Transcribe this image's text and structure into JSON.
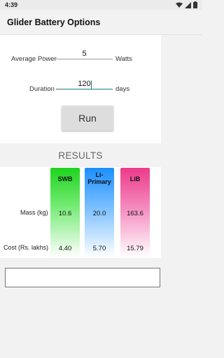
{
  "status_bar": {
    "time": "4:39",
    "icons": [
      "wifi-icon",
      "signal-icon",
      "battery-icon"
    ]
  },
  "app_bar": {
    "title": "Glider Battery Options"
  },
  "inputs": {
    "power": {
      "label": "Average Power",
      "value": "5",
      "unit": "Watts"
    },
    "duration": {
      "label": "Duration",
      "value": "120",
      "unit": "days"
    }
  },
  "run_button": {
    "label": "Run"
  },
  "results": {
    "title": "RESULTS",
    "row_labels": {
      "mass": "Mass (kg)",
      "cost": "Cost (Rs. lakhs)"
    },
    "columns": [
      {
        "name": "SWB",
        "mass": "10.6",
        "cost": "4.40",
        "color": "#1ed41e"
      },
      {
        "name": "Li-\nPrimary",
        "mass": "20.0",
        "cost": "5.70",
        "color": "#1b8fff"
      },
      {
        "name": "LiB",
        "mass": "163.6",
        "cost": "15.79",
        "color": "#ec3a8a"
      }
    ]
  },
  "output": {
    "text": ""
  },
  "colors": {
    "accent": "#1f7a7a",
    "background": "#f2f2f2"
  }
}
